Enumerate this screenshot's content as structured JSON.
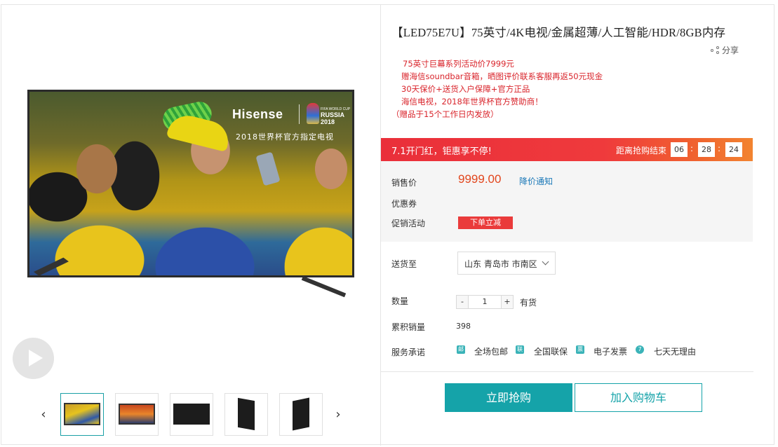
{
  "product": {
    "title": "【LED75E7U】75英寸/4K电视/金属超薄/人工智能/HDR/8GB内存",
    "share_label": "分享",
    "promo_lines": [
      "75英寸巨幕系列活动价7999元",
      "赠海信soundbar音箱，晒图评价联系客服再返50元现金",
      "30天保价+送货入户保障+官方正品",
      "海信电视，2018年世界杯官方赞助商！",
      "（赠品于15个工作日内发放）"
    ]
  },
  "hero": {
    "brand": "Hisense",
    "cup_small": "FIFA WORLD CUP",
    "cup_name": "RUSSIA",
    "cup_year": "2018",
    "slogan": "2018世界杯官方指定电视"
  },
  "gallery": {
    "prev": "‹",
    "next": "›"
  },
  "flash": {
    "text": "7.1开门红，钜惠享不停!",
    "countdown_label": "距离抢购结束",
    "hours": "06",
    "minutes": "28",
    "seconds": "24",
    "sep": ":"
  },
  "pricing": {
    "price_label": "销售价",
    "price": "9999.00",
    "notify_label": "降价通知",
    "coupon_label": "优惠券",
    "promotion_label": "促销活动",
    "promotion_badge": "下单立减"
  },
  "shipping": {
    "label": "送货至",
    "region": "山东 青岛市 市南区"
  },
  "quantity": {
    "label": "数量",
    "minus": "-",
    "value": "1",
    "plus": "+",
    "stock": "有货"
  },
  "sales": {
    "label": "累积销量",
    "count": "398"
  },
  "services": {
    "label": "服务承诺",
    "items": [
      {
        "icon": "邮",
        "text": "全场包邮"
      },
      {
        "icon": "联",
        "text": "全国联保"
      },
      {
        "icon": "票",
        "text": "电子发票"
      },
      {
        "icon": "7",
        "text": "七天无理由"
      }
    ]
  },
  "actions": {
    "buy": "立即抢购",
    "cart": "加入购物车"
  },
  "colors": {
    "accent": "#15a3a9",
    "promo_red": "#d9242b",
    "price_orange": "#e2461d"
  }
}
